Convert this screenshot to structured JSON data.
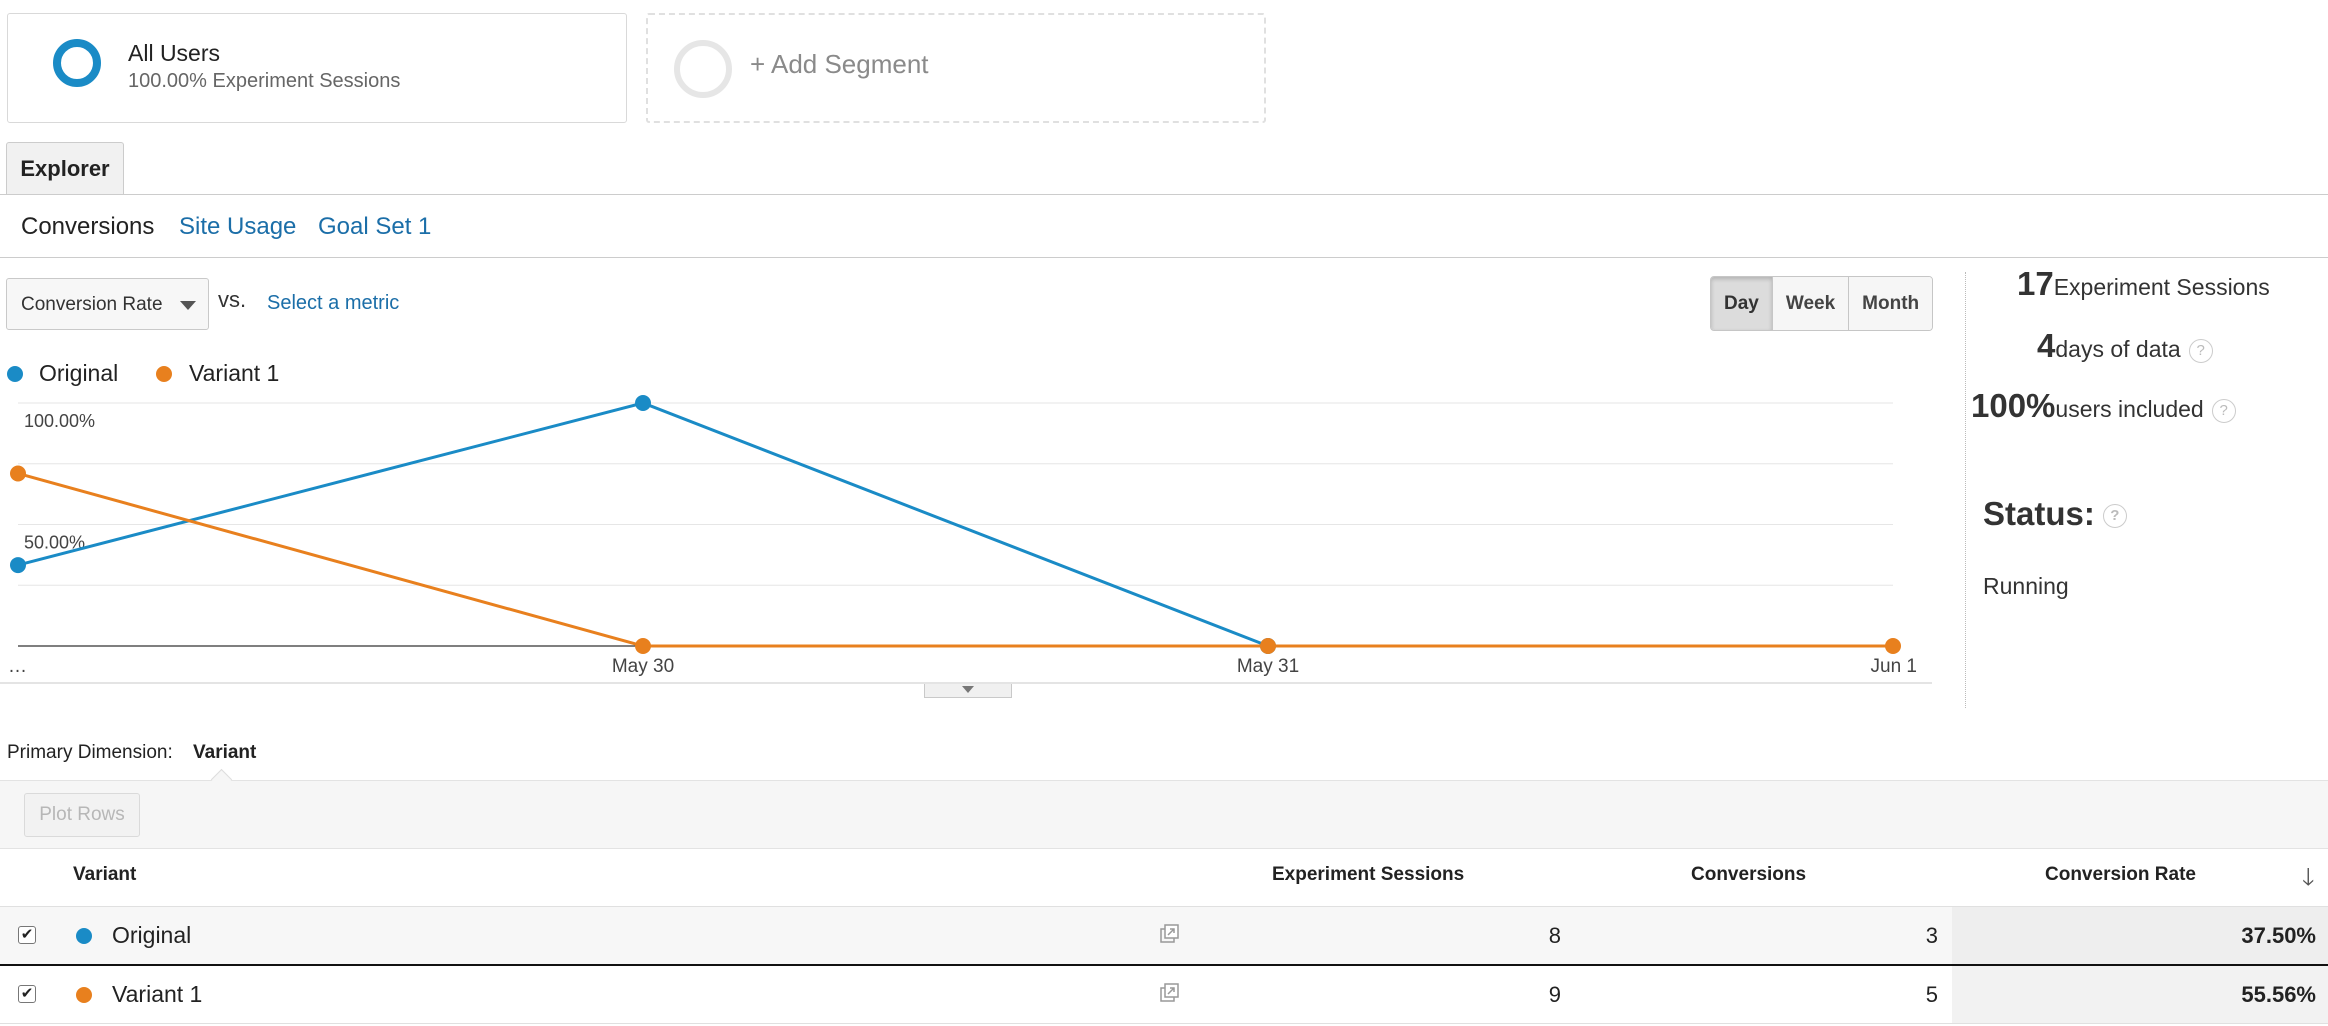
{
  "segments": {
    "all_users": {
      "title": "All Users",
      "subtitle": "100.00% Experiment Sessions"
    },
    "add_segment": {
      "label": "+ Add Segment"
    }
  },
  "tabs": {
    "explorer": "Explorer"
  },
  "subtabs": [
    "Conversions",
    "Site Usage",
    "Goal Set 1"
  ],
  "controls": {
    "metric": "Conversion Rate",
    "vs": "vs.",
    "select_metric": "Select a metric",
    "periods": [
      "Day",
      "Week",
      "Month"
    ],
    "active_period": "Day"
  },
  "stats": {
    "sessions_value": "17",
    "sessions_label": "Experiment Sessions",
    "days_value": "4",
    "days_label": "days of data",
    "users_value": "100%",
    "users_label": "users included",
    "status_label": "Status:",
    "status_value": "Running",
    "help_glyph": "?"
  },
  "table": {
    "primary_dimension_label": "Primary Dimension:",
    "primary_dimension_value": "Variant",
    "plot_rows": "Plot Rows",
    "headers": [
      "Variant",
      "Experiment Sessions",
      "Conversions",
      "Conversion Rate"
    ],
    "rows": [
      {
        "variant": "Original",
        "sessions": "8",
        "conversions": "3",
        "rate": "37.50%",
        "checked": true
      },
      {
        "variant": "Variant 1",
        "sessions": "9",
        "conversions": "5",
        "rate": "55.56%",
        "checked": true
      }
    ]
  },
  "colors": {
    "original": "#1a8bc6",
    "variant1": "#e8801e",
    "link": "#1b6ea8"
  },
  "chart_data": {
    "type": "line",
    "x": [
      "…",
      "May 30",
      "May 31",
      "Jun 1"
    ],
    "ytick_labels": [
      "100.00%",
      "50.00%"
    ],
    "yticks": [
      100,
      50
    ],
    "ylim": [
      0,
      100
    ],
    "series": [
      {
        "name": "Original",
        "color": "#1a8bc6",
        "values": [
          33.3,
          100,
          0,
          null
        ]
      },
      {
        "name": "Variant 1",
        "color": "#e8801e",
        "values": [
          71,
          0,
          0,
          0
        ]
      }
    ],
    "grid": true,
    "legend": "top-left"
  }
}
